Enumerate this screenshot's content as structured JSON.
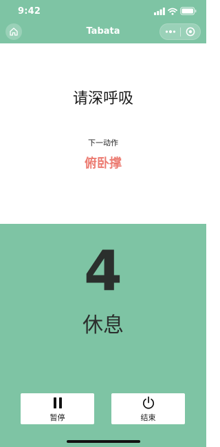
{
  "status_bar": {
    "time": "9:42"
  },
  "nav": {
    "title": "Tabata"
  },
  "workout": {
    "prompt": "请深呼吸",
    "next_label": "下一动作",
    "next_exercise": "俯卧撑",
    "countdown": "4",
    "phase": "休息"
  },
  "controls": {
    "pause_label": "暂停",
    "end_label": "结束"
  },
  "colors": {
    "accent": "#7ec4a4",
    "next_exercise": "#ec7c72",
    "countdown_text": "#2b2f2d"
  },
  "icons": {
    "home": "home-icon",
    "more": "more-dots-icon",
    "close": "close-target-icon",
    "pause": "pause-icon",
    "power": "power-icon",
    "signal": "signal-icon",
    "wifi": "wifi-icon",
    "battery": "battery-icon"
  }
}
